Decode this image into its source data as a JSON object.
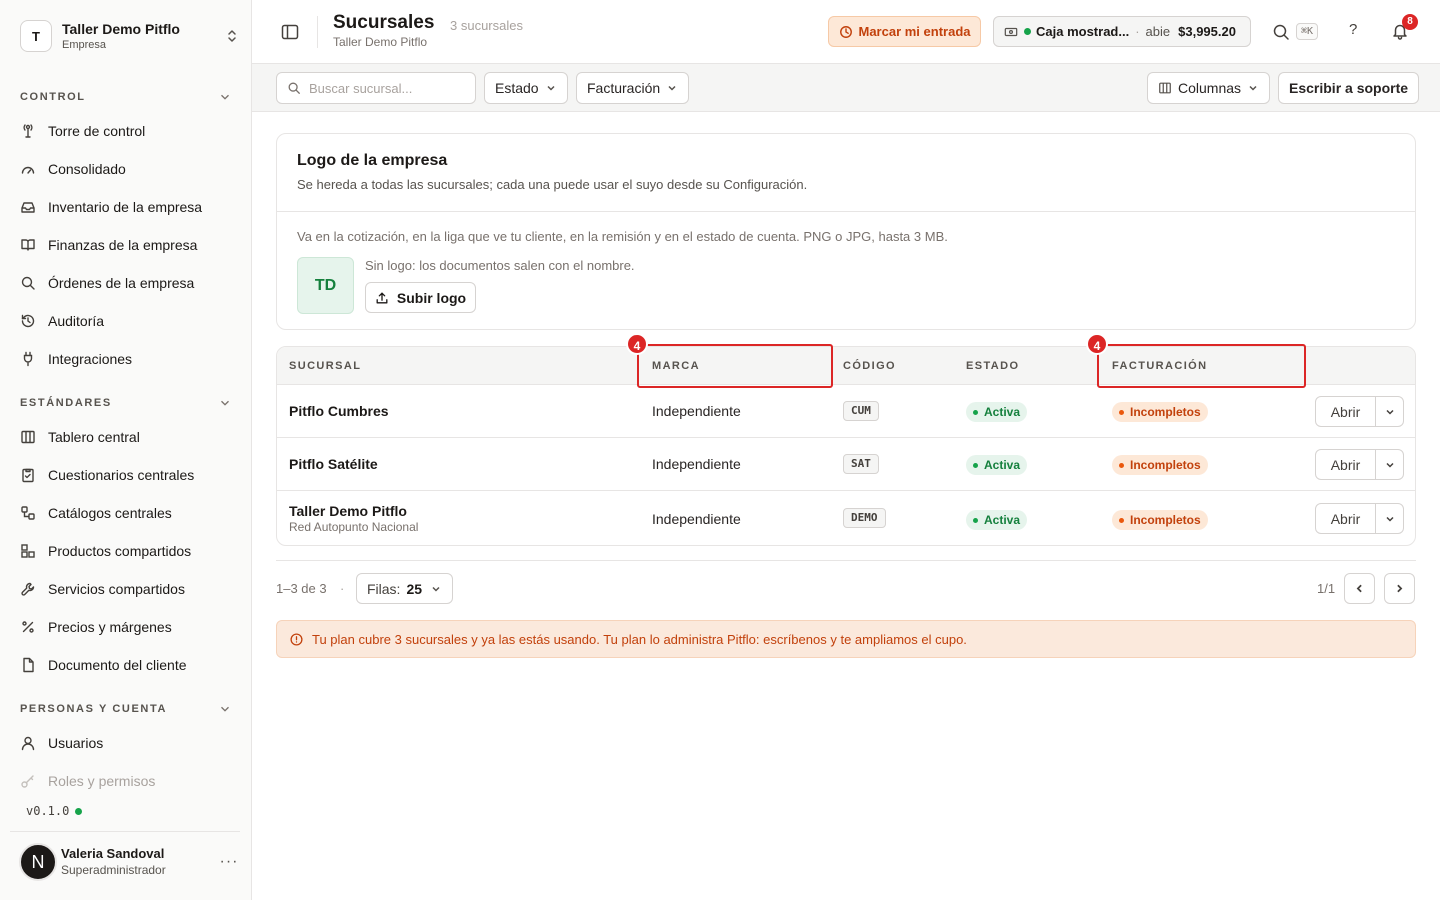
{
  "sidebar": {
    "org": {
      "initial": "T",
      "name": "Taller Demo Pitflo",
      "subtitle": "Empresa"
    },
    "sections": {
      "control": "CONTROL",
      "standards": "ESTÁNDARES",
      "people": "PERSONAS Y CUENTA"
    },
    "control_items": [
      {
        "label": "Torre de control",
        "icon": "tower-icon"
      },
      {
        "label": "Consolidado",
        "icon": "gauge-icon"
      },
      {
        "label": "Inventario de la empresa",
        "icon": "inbox-icon"
      },
      {
        "label": "Finanzas de la empresa",
        "icon": "book-icon"
      },
      {
        "label": "Órdenes de la empresa",
        "icon": "search-icon"
      },
      {
        "label": "Auditoría",
        "icon": "history-icon"
      },
      {
        "label": "Integraciones",
        "icon": "plug-icon"
      }
    ],
    "standards_items": [
      {
        "label": "Tablero central",
        "icon": "columns-icon"
      },
      {
        "label": "Cuestionarios centrales",
        "icon": "clipboard-icon"
      },
      {
        "label": "Catálogos centrales",
        "icon": "workflow-icon"
      },
      {
        "label": "Productos compartidos",
        "icon": "boxes-icon"
      },
      {
        "label": "Servicios compartidos",
        "icon": "wrench-icon"
      },
      {
        "label": "Precios y márgenes",
        "icon": "percent-icon"
      },
      {
        "label": "Documento del cliente",
        "icon": "file-icon"
      }
    ],
    "people_items": [
      {
        "label": "Usuarios",
        "icon": "user-icon"
      },
      {
        "label": "Roles y permisos",
        "icon": "key-icon"
      }
    ],
    "version": "v0.1.0",
    "user": {
      "initial": "N",
      "name": "Valeria Sandoval",
      "role": "Superadministrador",
      "more": "···"
    }
  },
  "header": {
    "title": "Sucursales",
    "count": "3 sucursales",
    "subtitle": "Taller Demo Pitflo",
    "checkin_label": "Marcar mi entrada",
    "cash": {
      "name": "Caja mostrad...",
      "separator": "·",
      "status": "abie",
      "amount": "$3,995.20"
    },
    "shortcut": "⌘K",
    "help": "?",
    "notifications": "8"
  },
  "toolbar": {
    "search_placeholder": "Buscar sucursal...",
    "filter_status": "Estado",
    "filter_billing": "Facturación",
    "columns": "Columnas",
    "support": "Escribir a soporte"
  },
  "logo_card": {
    "title": "Logo de la empresa",
    "description": "Se hereda a todas las sucursales; cada una puede usar el suyo desde su Configuración.",
    "hint": "Va en la cotización, en la liga que ve tu cliente, en la remisión y en el estado de cuenta. PNG o JPG, hasta 3 MB.",
    "placeholder_initials": "TD",
    "note": "Sin logo: los documentos salen con el nombre.",
    "upload_label": "Subir logo"
  },
  "table": {
    "headers": {
      "branch": "SUCURSAL",
      "brand": "MARCA",
      "code": "CÓDIGO",
      "status": "ESTADO",
      "billing": "FACTURACIÓN"
    },
    "markers": {
      "brand": "4",
      "billing": "4"
    },
    "rows": [
      {
        "name": "Pitflo Cumbres",
        "subtitle": "",
        "brand": "Independiente",
        "code": "CUM",
        "status": "Activa",
        "billing": "Incompletos",
        "action": "Abrir"
      },
      {
        "name": "Pitflo Satélite",
        "subtitle": "",
        "brand": "Independiente",
        "code": "SAT",
        "status": "Activa",
        "billing": "Incompletos",
        "action": "Abrir"
      },
      {
        "name": "Taller Demo Pitflo",
        "subtitle": "Red Autopunto Nacional",
        "brand": "Independiente",
        "code": "DEMO",
        "status": "Activa",
        "billing": "Incompletos",
        "action": "Abrir"
      }
    ]
  },
  "pagination": {
    "range": "1–3 de 3",
    "separator": "·",
    "rows_label": "Filas:",
    "rows_value": "25",
    "page": "1/1"
  },
  "alert": {
    "text": "Tu plan cubre 3 sucursales y ya las estás usando. Tu plan lo administra Pitflo: escríbenos y te ampliamos el cupo."
  }
}
